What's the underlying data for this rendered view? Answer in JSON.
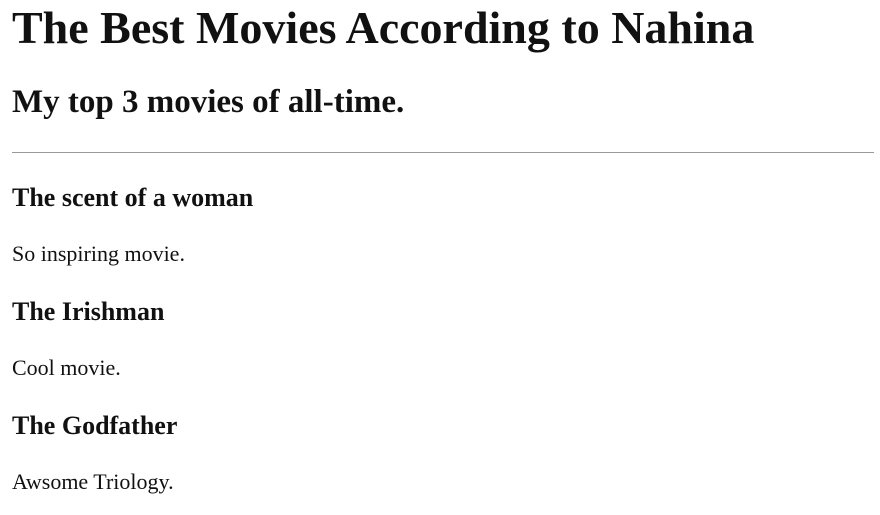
{
  "page": {
    "title": "The Best Movies According to Nahina",
    "subtitle": "My top 3 movies of all-time."
  },
  "movies": [
    {
      "title": "The scent of a woman",
      "description": "So inspiring movie."
    },
    {
      "title": "The Irishman",
      "description": "Cool movie."
    },
    {
      "title": "The Godfather",
      "description": "Awsome Triology."
    }
  ],
  "colors": {
    "text": "#111111",
    "divider": "#9a9a9a",
    "background": "#ffffff"
  }
}
